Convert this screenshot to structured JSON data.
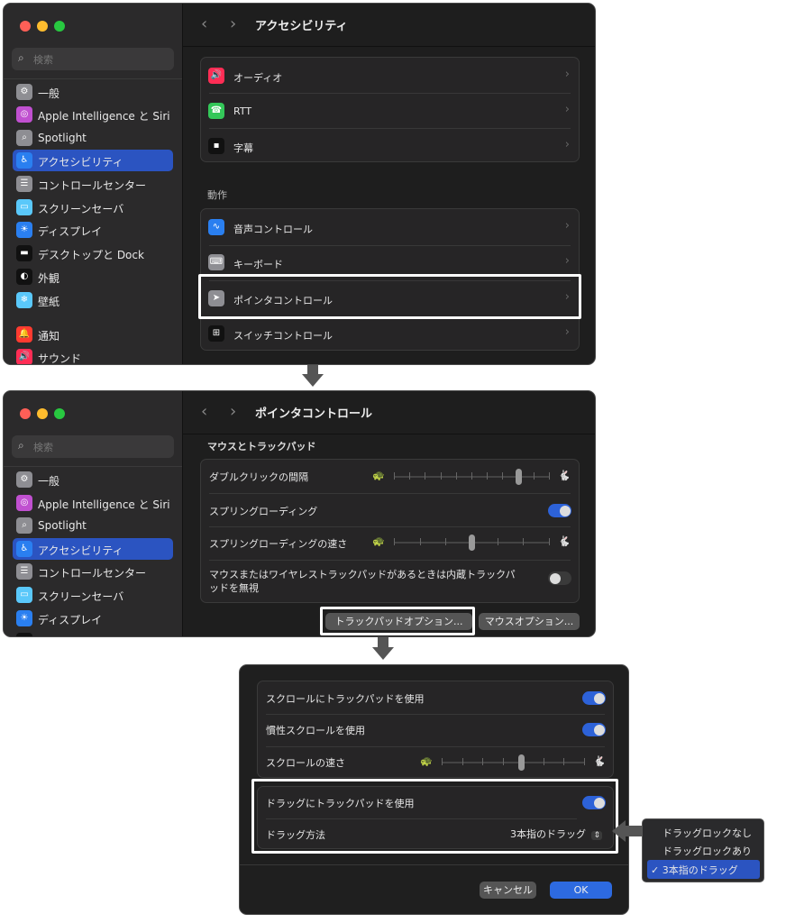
{
  "window_controls": {
    "close": "#ff5f57",
    "minimize": "#febc2e",
    "zoom": "#28c840"
  },
  "sidebar": {
    "search_placeholder": "検索",
    "items": [
      {
        "label": "一般",
        "icon": "gear-icon",
        "color": "#8e8e93"
      },
      {
        "label": "Apple Intelligence と Siri",
        "icon": "siri-icon",
        "color": "#c050d0"
      },
      {
        "label": "Spotlight",
        "icon": "magnifier-icon",
        "color": "#8e8e93"
      },
      {
        "label": "アクセシビリティ",
        "icon": "accessibility-icon",
        "color": "#2a7ff0",
        "selected": true
      },
      {
        "label": "コントロールセンター",
        "icon": "switches-icon",
        "color": "#8e8e93"
      },
      {
        "label": "スクリーンセーバ",
        "icon": "screensaver-icon",
        "color": "#5ac8fa"
      },
      {
        "label": "ディスプレイ",
        "icon": "sun-icon",
        "color": "#2a7ff0"
      },
      {
        "label": "デスクトップと Dock",
        "icon": "dock-icon",
        "color": "#111111"
      },
      {
        "label": "外観",
        "icon": "appearance-icon",
        "color": "#111111"
      },
      {
        "label": "壁紙",
        "icon": "wallpaper-icon",
        "color": "#5ac8fa"
      },
      {
        "label": "通知",
        "icon": "bell-icon",
        "color": "#ff3b30"
      },
      {
        "label": "サウンド",
        "icon": "speaker-icon",
        "color": "#ff2d55"
      }
    ]
  },
  "panel1": {
    "title": "アクセシビリティ",
    "group1": [
      {
        "label": "オーディオ",
        "icon": "speaker-icon",
        "color": "#ff2d55"
      },
      {
        "label": "RTT",
        "icon": "tty-icon",
        "color": "#34c759"
      },
      {
        "label": "字幕",
        "icon": "caption-icon",
        "color": "#111111"
      }
    ],
    "section": "動作",
    "group2": [
      {
        "label": "音声コントロール",
        "icon": "waveform-icon",
        "color": "#2a7ff0"
      },
      {
        "label": "キーボード",
        "icon": "keyboard-icon",
        "color": "#8e8e93"
      },
      {
        "label": "ポインタコントロール",
        "icon": "pointer-icon",
        "color": "#8e8e93",
        "highlighted": true
      },
      {
        "label": "スイッチコントロール",
        "icon": "grid-icon",
        "color": "#111111"
      }
    ]
  },
  "panel2": {
    "title": "ポインタコントロール",
    "section": "マウスとトラックパッド",
    "double_click": {
      "label": "ダブルクリックの間隔",
      "value": 0.8,
      "ticks": 11
    },
    "spring_loading": {
      "label": "スプリングローディング",
      "on": true
    },
    "spring_speed": {
      "label": "スプリングローディングの速さ",
      "value": 0.5,
      "ticks": 7
    },
    "ignore_trackpad": {
      "label": "マウスまたはワイヤレストラックパッドがあるときは内蔵トラックパッドを無視",
      "on": false
    },
    "trackpad_options": "トラックパッドオプション...",
    "mouse_options": "マウスオプション..."
  },
  "panel3": {
    "scroll_trackpad": {
      "label": "スクロールにトラックパッドを使用",
      "on": true
    },
    "inertia": {
      "label": "慣性スクロールを使用",
      "on": true
    },
    "scroll_speed": {
      "label": "スクロールの速さ",
      "value": 0.56,
      "ticks": 8
    },
    "drag_trackpad": {
      "label": "ドラッグにトラックパッドを使用",
      "on": true
    },
    "drag_method": {
      "label": "ドラッグ方法",
      "value": "3本指のドラッグ"
    },
    "cancel": "キャンセル",
    "ok": "OK"
  },
  "drag_menu": {
    "options": [
      "ドラッグロックなし",
      "ドラッグロックあり",
      "3本指のドラッグ"
    ],
    "selected": 2,
    "check": "✓"
  }
}
